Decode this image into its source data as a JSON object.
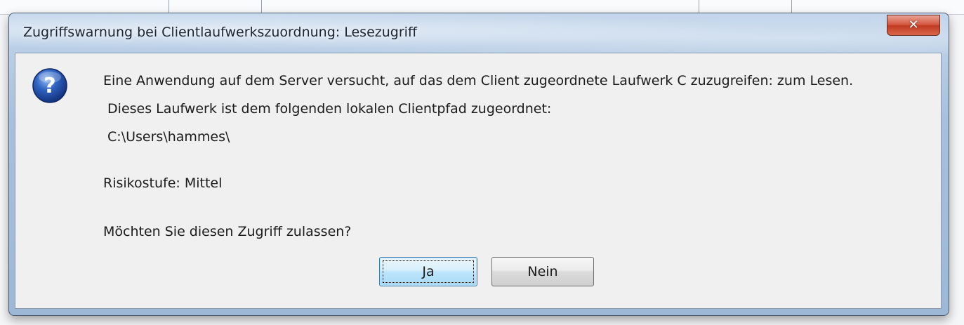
{
  "dialog": {
    "title": "Zugriffswarnung bei Clientlaufwerkszuordnung: Lesezugriff",
    "close_icon": "close-icon",
    "message_icon": "question-icon",
    "lines": [
      "Eine Anwendung auf dem Server versucht, auf das dem Client zugeordnete Laufwerk C zuzugreifen: zum Lesen.",
      " Dieses Laufwerk ist dem folgenden lokalen Clientpfad zugeordnet:",
      " C:\\Users\\hammes\\",
      "Risikostufe: Mittel",
      "Möchten Sie diesen Zugriff zulassen?"
    ],
    "buttons": {
      "yes": "Ja",
      "no": "Nein"
    }
  },
  "colors": {
    "titlebar": "#a7c0dc",
    "client": "#f0f0f0",
    "close": "#c13a22",
    "default_button": "#bee6fd"
  }
}
